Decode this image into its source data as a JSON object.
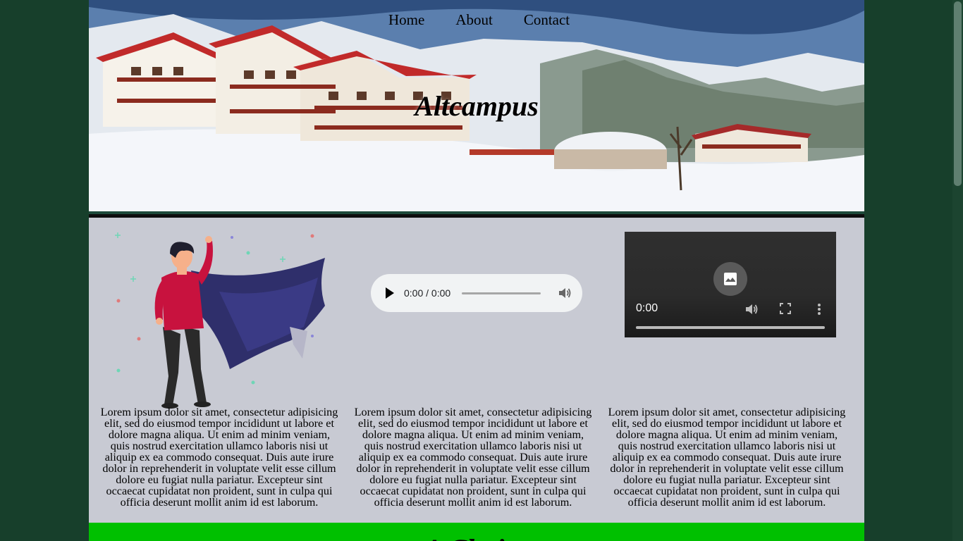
{
  "nav": {
    "items": [
      "Home",
      "About",
      "Contact"
    ]
  },
  "hero": {
    "title": "Altcampus"
  },
  "media": {
    "audio_time": "0:00 / 0:00",
    "video_time": "0:00"
  },
  "columns": [
    {
      "text": "Lorem ipsum dolor sit amet, consectetur adipisicing elit, sed do eiusmod tempor incididunt ut labore et dolore magna aliqua. Ut enim ad minim veniam, quis nostrud exercitation ullamco laboris nisi ut aliquip ex ea commodo consequat. Duis aute irure dolor in reprehenderit in voluptate velit esse cillum dolore eu fugiat nulla pariatur. Excepteur sint occaecat cupidatat non proident, sunt in culpa qui officia deserunt mollit anim id est laborum."
    },
    {
      "text": "Lorem ipsum dolor sit amet, consectetur adipisicing elit, sed do eiusmod tempor incididunt ut labore et dolore magna aliqua. Ut enim ad minim veniam, quis nostrud exercitation ullamco laboris nisi ut aliquip ex ea commodo consequat. Duis aute irure dolor in reprehenderit in voluptate velit esse cillum dolore eu fugiat nulla pariatur. Excepteur sint occaecat cupidatat non proident, sunt in culpa qui officia deserunt mollit anim id est laborum."
    },
    {
      "text": "Lorem ipsum dolor sit amet, consectetur adipisicing elit, sed do eiusmod tempor incididunt ut labore et dolore magna aliqua. Ut enim ad minim veniam, quis nostrud exercitation ullamco laboris nisi ut aliquip ex ea commodo consequat. Duis aute irure dolor in reprehenderit in voluptate velit esse cillum dolore eu fugiat nulla pariatur. Excepteur sint occaecat cupidatat non proident, sunt in culpa qui officia deserunt mollit anim id est laborum."
    }
  ],
  "section": {
    "heading": "A Choice"
  },
  "colors": {
    "page_background": "#173f2b",
    "content_background": "#c8cad3",
    "band_green": "#00c000"
  }
}
